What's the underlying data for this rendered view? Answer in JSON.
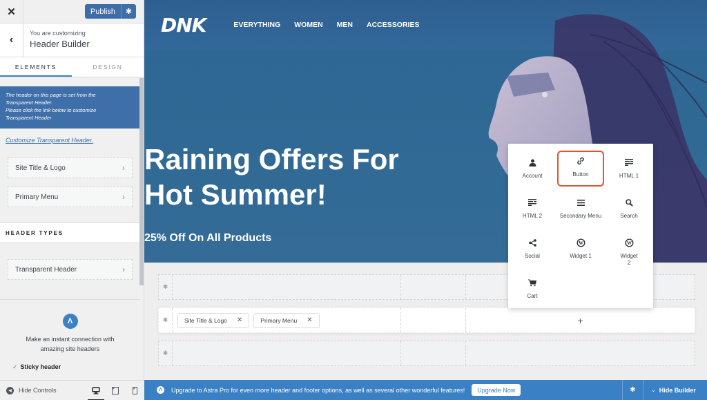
{
  "sidebar": {
    "close_icon": "close-icon",
    "publish_label": "Publish",
    "customizing_label": "You are customizing",
    "section_title": "Header Builder",
    "tabs": [
      {
        "label": "ELEMENTS",
        "active": true
      },
      {
        "label": "DESIGN",
        "active": false
      }
    ],
    "notice": {
      "line1": "The header on this page is set from the",
      "line2": "Transparent Header.",
      "line3": "Please click the link below to customize",
      "line4": "Transparent Header"
    },
    "customize_link": "Customize Transparent Header.",
    "items": [
      {
        "label": "Site Title & Logo"
      },
      {
        "label": "Primary Menu"
      }
    ],
    "header_types_title": "HEADER TYPES",
    "header_types": [
      {
        "label": "Transparent Header"
      }
    ],
    "promo": {
      "text_line1": "Make an instant connection with",
      "text_line2": "amazing site headers",
      "check": "Sticky header"
    },
    "footer": {
      "hide_controls": "Hide Controls",
      "devices": [
        "desktop",
        "tablet",
        "mobile"
      ],
      "active_device": "desktop"
    }
  },
  "site": {
    "logo": "DNK",
    "nav": [
      "EVERYTHING",
      "WOMEN",
      "MEN",
      "ACCESSORIES"
    ],
    "hero_title_line1": "Raining Offers For",
    "hero_title_line2": "Hot Summer!",
    "hero_subtitle": "25% Off On All Products"
  },
  "builder": {
    "rows": [
      {
        "type": "above",
        "chips": []
      },
      {
        "type": "primary",
        "chips": [
          "Site Title & Logo",
          "Primary Menu"
        ]
      },
      {
        "type": "below",
        "chips": []
      }
    ],
    "add_symbol": "+"
  },
  "element_picker": {
    "items": [
      {
        "label": "Account",
        "icon": "account-icon",
        "highlighted": false
      },
      {
        "label": "Button",
        "icon": "link-icon",
        "highlighted": true
      },
      {
        "label": "HTML 1",
        "icon": "html-icon",
        "highlighted": false
      },
      {
        "label": "HTML 2",
        "icon": "html-icon",
        "highlighted": false
      },
      {
        "label": "Secondary Menu",
        "icon": "menu-icon",
        "highlighted": false
      },
      {
        "label": "Search",
        "icon": "search-icon",
        "highlighted": false
      },
      {
        "label": "Social",
        "icon": "share-icon",
        "highlighted": false
      },
      {
        "label": "Widget 1",
        "icon": "wordpress-icon",
        "highlighted": false
      },
      {
        "label": "Widget 2",
        "icon": "wordpress-icon",
        "highlighted": false
      },
      {
        "label": "Cart",
        "icon": "cart-icon",
        "highlighted": false
      }
    ],
    "highlight_color": "#e4532e"
  },
  "upgrade_bar": {
    "text": "Upgrade to Astra Pro for even more header and footer options, as well as several other wonderful features!",
    "button": "Upgrade Now",
    "hide_builder": "Hide Builder"
  },
  "colors": {
    "primary": "#3d6ea8",
    "bar_blue": "#3a80c4",
    "hero_blue": "#33689a"
  }
}
